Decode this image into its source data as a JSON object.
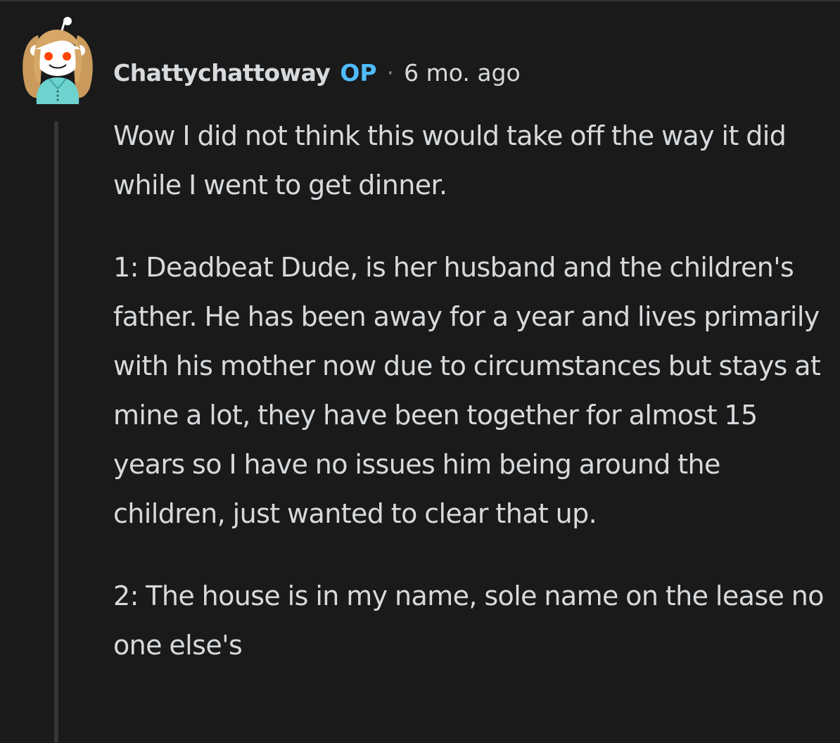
{
  "comment": {
    "author": "Chattychattoway",
    "badge": "OP",
    "separator": "·",
    "time": "6 mo. ago",
    "avatar_icon": "snoo-avatar-icon",
    "paragraphs": [
      "Wow I did not think this would take off the way it did while I went to get dinner.",
      "1: Deadbeat Dude, is her husband and the children's father. He has been away for a year and lives primarily with his mother now due to circumstances but stays at mine a lot, they have been together for almost 15 years so I have no issues him being around the children, just wanted to clear that up.",
      "2: The house is in my name, sole name on the lease no one else's"
    ]
  },
  "colors": {
    "background": "#1a1a1b",
    "text": "#d7dadc",
    "op_badge": "#4fbcff",
    "thread_line": "#343536",
    "muted": "#818384"
  }
}
